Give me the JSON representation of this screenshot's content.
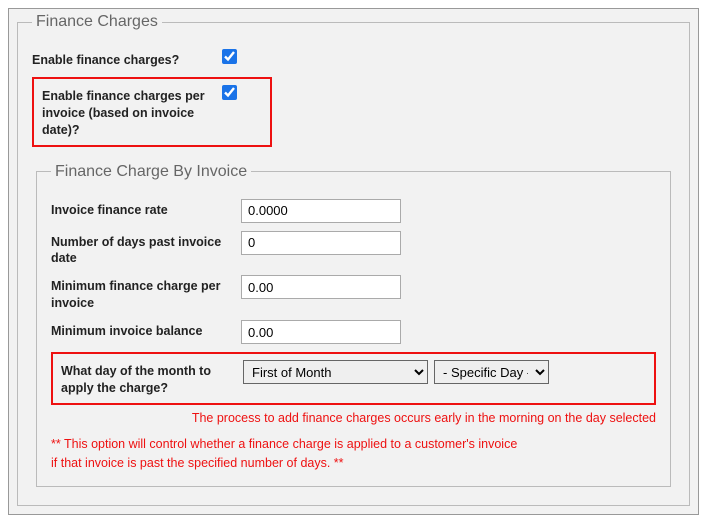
{
  "outer": {
    "legend": "Finance Charges",
    "enable_label": "Enable finance charges?",
    "enable_checked": true,
    "per_invoice_label": "Enable finance charges per invoice (based on invoice date)?",
    "per_invoice_checked": true
  },
  "inner": {
    "legend": "Finance Charge By Invoice",
    "rate_label": "Invoice finance rate",
    "rate_value": "0.0000",
    "days_label": "Number of days past invoice date",
    "days_value": "0",
    "min_charge_label": "Minimum finance charge per invoice",
    "min_charge_value": "0.00",
    "min_balance_label": "Minimum invoice balance",
    "min_balance_value": "0.00",
    "apply_day_label": "What day of the month to apply the charge?",
    "apply_day_mode": "First of Month",
    "apply_day_specific": "- Specific Day -",
    "process_note": "The process to add finance charges occurs early in the morning on the day selected",
    "option_note_1": "** This option will control whether a finance charge is applied to a customer's invoice",
    "option_note_2": "if that invoice is past the specified number of days. **"
  }
}
